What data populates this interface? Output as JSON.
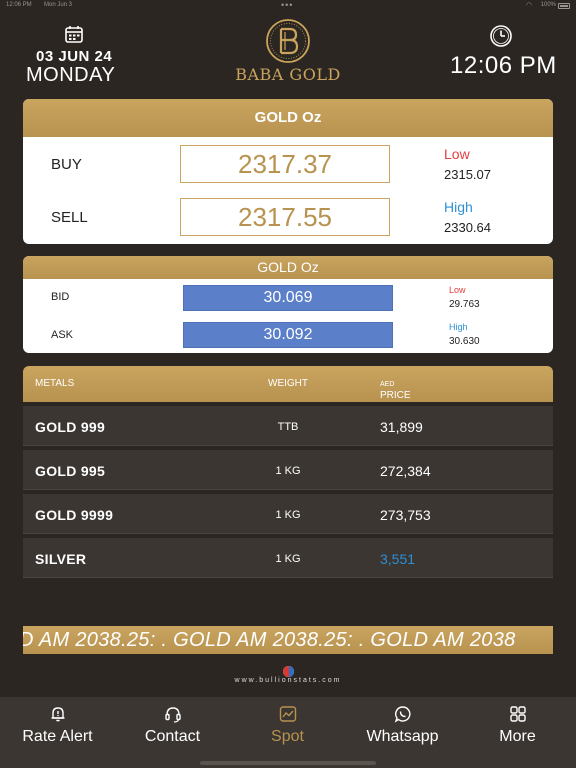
{
  "status_bar": {
    "time": "12:06 PM",
    "date": "Mon Jun 3",
    "battery": "100%"
  },
  "header": {
    "date": "03 JUN 24",
    "day": "MONDAY",
    "brand": "BABA GOLD",
    "time": "12:06 PM"
  },
  "spot": {
    "title": "GOLD Oz",
    "buy_label": "BUY",
    "buy_value": "2317.37",
    "sell_label": "SELL",
    "sell_value": "2317.55",
    "low_label": "Low",
    "low_value": "2315.07",
    "high_label": "High",
    "high_value": "2330.64"
  },
  "bidask": {
    "title": "GOLD Oz",
    "bid_label": "BID",
    "bid_value": "30.069",
    "ask_label": "ASK",
    "ask_value": "30.092",
    "low_label": "Low",
    "low_value": "29.763",
    "high_label": "High",
    "high_value": "30.630"
  },
  "metals": {
    "headers": {
      "metals": "METALS",
      "weight": "WEIGHT",
      "price": "PRICE",
      "price_unit": "AED"
    },
    "rows": [
      {
        "name": "GOLD 999",
        "weight": "TTB",
        "price": "31,899"
      },
      {
        "name": "GOLD 995",
        "weight": "1 KG",
        "price": "272,384"
      },
      {
        "name": "GOLD 9999",
        "weight": "1 KG",
        "price": "273,753"
      },
      {
        "name": "SILVER",
        "weight": "1 KG",
        "price": "3,551"
      }
    ]
  },
  "ticker": {
    "text": "D AM 2038.25: .  GOLD AM 2038.25: .  GOLD AM 2038"
  },
  "footer": {
    "site": "www.bullionstats.com"
  },
  "tabs": [
    {
      "label": "Rate Alert",
      "icon": "bell-icon"
    },
    {
      "label": "Contact",
      "icon": "headset-icon"
    },
    {
      "label": "Spot",
      "icon": "chart-icon"
    },
    {
      "label": "Whatsapp",
      "icon": "whatsapp-icon"
    },
    {
      "label": "More",
      "icon": "grid-icon"
    }
  ],
  "colors": {
    "background": "#2b2622",
    "gold": "#b8924f",
    "low": "#e33d3d",
    "high": "#2d8fd6",
    "bid_box": "#5b7fc8"
  }
}
